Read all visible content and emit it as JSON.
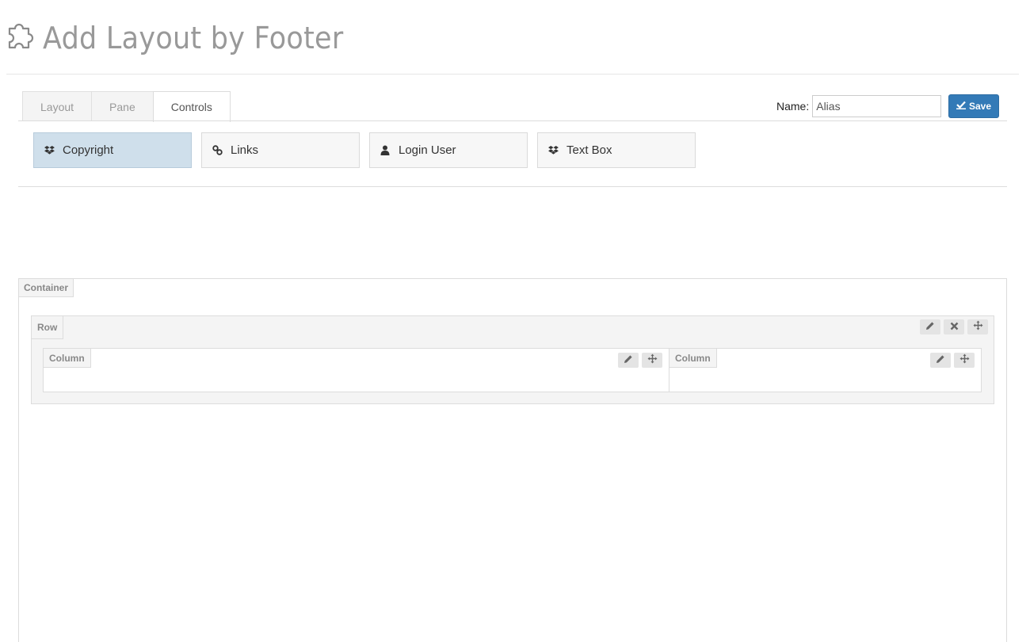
{
  "header": {
    "title": "Add Layout by Footer",
    "icon": "puzzle-icon"
  },
  "tabs": [
    {
      "label": "Layout",
      "active": false
    },
    {
      "label": "Pane",
      "active": false
    },
    {
      "label": "Controls",
      "active": true
    }
  ],
  "name_field": {
    "label": "Name:",
    "value": "Alias"
  },
  "save_button": {
    "label": "Save",
    "icon": "checkmark-icon",
    "color": "#337ab7"
  },
  "controls": [
    {
      "label": "Copyright",
      "icon": "dropbox-icon",
      "selected": true
    },
    {
      "label": "Links",
      "icon": "link-icon",
      "selected": false
    },
    {
      "label": "Login User",
      "icon": "user-icon",
      "selected": false
    },
    {
      "label": "Text Box",
      "icon": "dropbox-icon",
      "selected": false
    }
  ],
  "canvas": {
    "container_label": "Container",
    "row_label": "Row",
    "columns": [
      {
        "label": "Column"
      },
      {
        "label": "Column"
      }
    ]
  }
}
